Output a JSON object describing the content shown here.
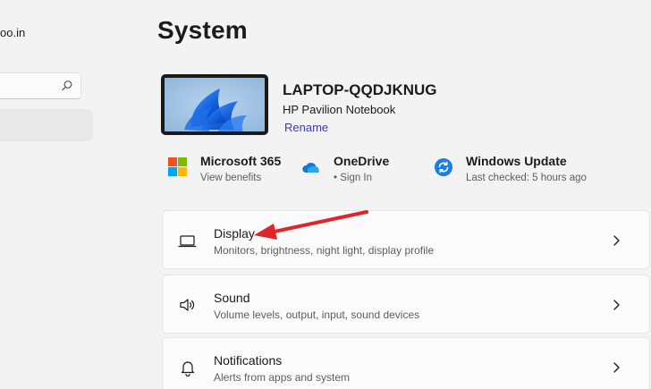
{
  "sidebar": {
    "account_email_fragment": "oo.in",
    "search": {
      "placeholder": ""
    },
    "selected_item": "System"
  },
  "page": {
    "title": "System"
  },
  "device": {
    "name": "LAPTOP-QQDJKNUG",
    "model": "HP Pavilion Notebook",
    "rename_label": "Rename",
    "image_icon": "windows-11-bloom-wallpaper"
  },
  "quick_links": [
    {
      "title": "Microsoft 365",
      "subtitle": "View benefits",
      "icon": "microsoft-logo-icon"
    },
    {
      "title": "OneDrive",
      "subtitle": "• Sign In",
      "icon": "onedrive-cloud-icon"
    },
    {
      "title": "Windows Update",
      "subtitle": "Last checked: 5 hours ago",
      "icon": "windows-update-icon"
    }
  ],
  "settings": [
    {
      "title": "Display",
      "description": "Monitors, brightness, night light, display profile",
      "icon": "monitor-icon"
    },
    {
      "title": "Sound",
      "description": "Volume levels, output, input, sound devices",
      "icon": "speaker-icon"
    },
    {
      "title": "Notifications",
      "description": "Alerts from apps and system",
      "icon": "bell-icon"
    }
  ],
  "colors": {
    "accent_link": "#3b3ca8",
    "annotation_arrow": "#e0242a",
    "window_background": "#f3f3f3",
    "card_background": "#fbfbfb"
  }
}
